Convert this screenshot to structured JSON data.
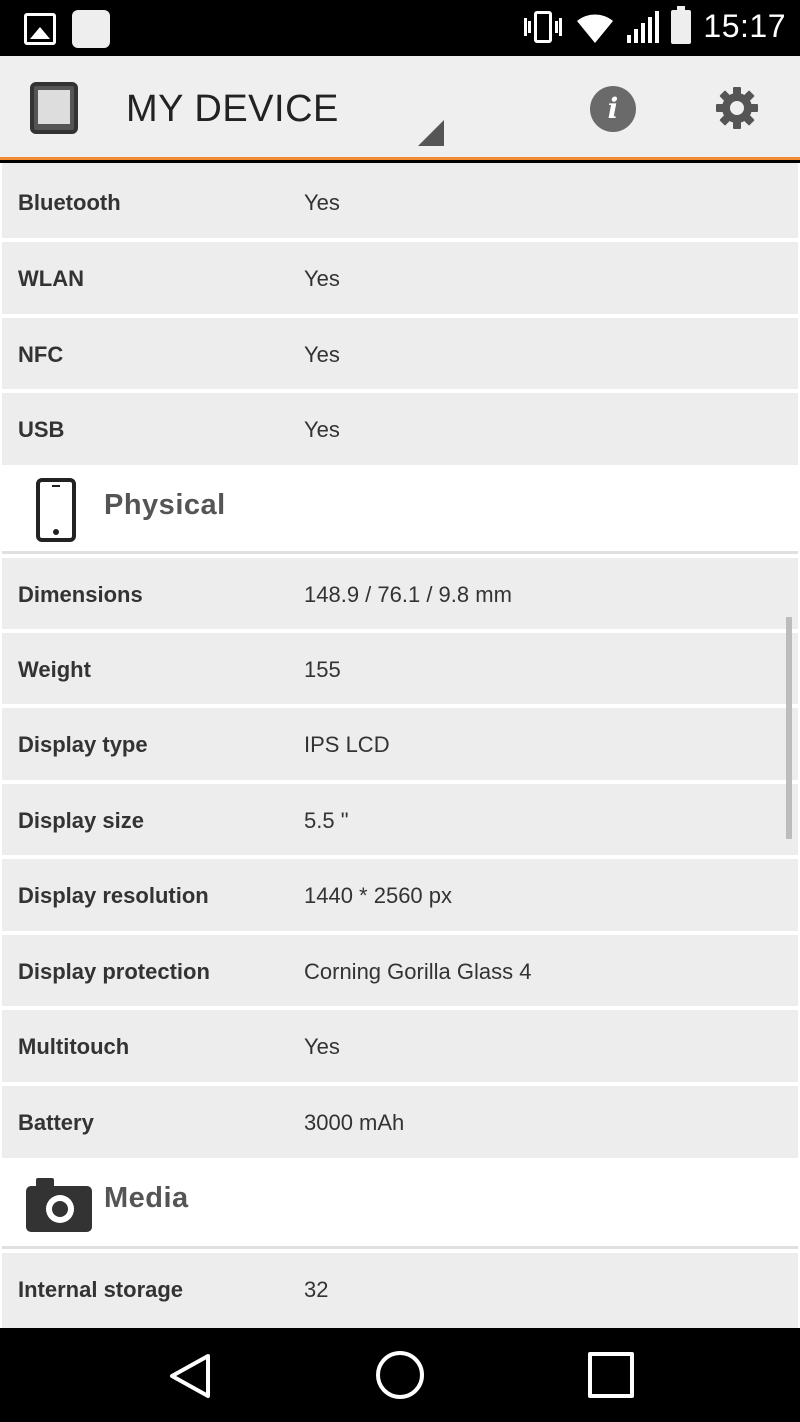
{
  "status_bar": {
    "time": "15:17",
    "icons": [
      "image-icon",
      "notification-square-icon",
      "vibrate-icon",
      "wifi-icon",
      "signal-icon",
      "battery-icon"
    ]
  },
  "app_bar": {
    "title": "MY DEVICE",
    "icons": [
      "tablet-icon",
      "dropdown-triangle-icon",
      "info-icon",
      "gear-icon"
    ],
    "accent_color": "#f28c32"
  },
  "rows_top": [
    {
      "label": "Bluetooth",
      "value": "Yes"
    },
    {
      "label": "WLAN",
      "value": "Yes"
    },
    {
      "label": "NFC",
      "value": "Yes"
    },
    {
      "label": "USB",
      "value": "Yes"
    }
  ],
  "sections": {
    "physical": {
      "title": "Physical",
      "icon": "phone-icon"
    },
    "media": {
      "title": "Media",
      "icon": "camera-icon"
    }
  },
  "rows_physical": [
    {
      "label": "Dimensions",
      "value": "148.9 / 76.1 / 9.8 mm"
    },
    {
      "label": "Weight",
      "value": "155"
    },
    {
      "label": "Display type",
      "value": "IPS LCD"
    },
    {
      "label": "Display size",
      "value": "5.5 \""
    },
    {
      "label": "Display resolution",
      "value": "1440 * 2560 px"
    },
    {
      "label": "Display protection",
      "value": "Corning Gorilla Glass 4"
    },
    {
      "label": "Multitouch",
      "value": "Yes"
    },
    {
      "label": "Battery",
      "value": "3000 mAh"
    }
  ],
  "rows_media": [
    {
      "label": "Internal storage",
      "value": "32"
    }
  ],
  "nav_bar": {
    "icons": [
      "back-icon",
      "home-icon",
      "recent-apps-icon"
    ]
  }
}
